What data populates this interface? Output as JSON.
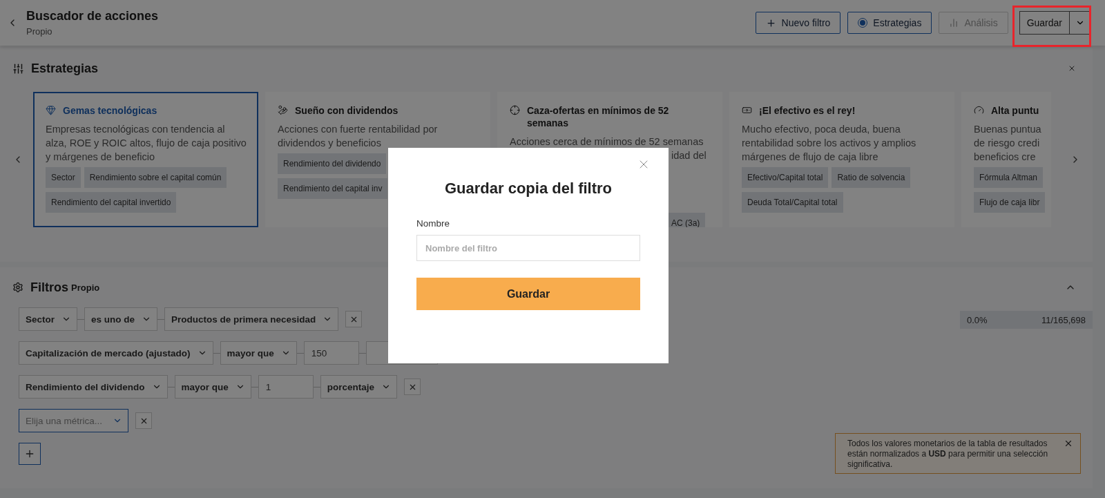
{
  "header": {
    "title": "Buscador de acciones",
    "subtitle": "Propio",
    "new_filter_button": {
      "label": "Nuevo filtro"
    },
    "strategies_toggle": {
      "label": "Estrategias",
      "checked": true
    },
    "analysis_button": {
      "label": "Análisis",
      "disabled": true
    },
    "save_button": {
      "label": "Guardar",
      "highlighted": true
    }
  },
  "strategies": {
    "title": "Estrategias",
    "cards": [
      {
        "kind": "full",
        "selected": true,
        "title": "Gemas tecnológicas",
        "description": "Empresas tecnológicas con tendencia al alza, ROE y ROIC altos, flujo de caja positivo y márgenes de beneficio",
        "tags": [
          "Sector",
          "Rendimiento sobre el capital común",
          "Rendimiento del capital invertido"
        ]
      },
      {
        "kind": "full",
        "selected": false,
        "title": "Sueño con dividendos",
        "description": "Acciones con fuerte rentabilidad por dividendos y beneficios",
        "tags": [
          "Rendimiento del dividendo",
          "Rendimiento del capital inv"
        ]
      },
      {
        "kind": "covered",
        "selected": false,
        "title": "Caza-ofertas en mínimos de 52 semanas",
        "description": "Acciones cerca de mínimos de 52 semanas",
        "description_tail": "idad del",
        "tag_tail": "AC (3a)"
      },
      {
        "kind": "full",
        "selected": false,
        "title": "¡El efectivo es el rey!",
        "description": "Mucho efectivo, poca deuda, buena rentabilidad sobre los activos y amplios márgenes de flujo de caja libre",
        "tags": [
          "Efectivo/Capital total",
          "Ratio de solvencia",
          "Deuda Total/Capital total"
        ]
      },
      {
        "kind": "cut",
        "selected": false,
        "title": "Alta puntu",
        "description_lines": [
          "Buenas puntua",
          "de riesgo credi",
          "beneficios cre"
        ],
        "tags": [
          "Fórmula Altman",
          "Flujo de caja libr"
        ]
      }
    ]
  },
  "filters": {
    "title": "Filtros",
    "subtitle": "Propio",
    "conditions": [
      {
        "parts": [
          {
            "kind": "select",
            "value": "Sector"
          },
          {
            "kind": "select",
            "value": "es uno de"
          },
          {
            "kind": "select",
            "value": "Productos de primera necesidad"
          },
          {
            "kind": "remove"
          }
        ]
      },
      {
        "parts": [
          {
            "kind": "select",
            "value": "Capitalización de mercado (ajustado)"
          },
          {
            "kind": "select",
            "value": "mayor que"
          },
          {
            "kind": "input",
            "value": "150"
          },
          {
            "kind": "covered"
          }
        ]
      },
      {
        "parts": [
          {
            "kind": "select",
            "value": "Rendimiento del dividendo"
          },
          {
            "kind": "select",
            "value": "mayor que"
          },
          {
            "kind": "input",
            "value": "1"
          },
          {
            "kind": "select",
            "value": "porcentaje"
          },
          {
            "kind": "remove"
          }
        ]
      },
      {
        "parts": [
          {
            "kind": "placeholder",
            "value": "Elija una métrica..."
          },
          {
            "kind": "remove"
          }
        ]
      }
    ],
    "stats": {
      "share": "0.0%",
      "count": "11/165,698"
    }
  },
  "notice": {
    "text": "Todos los valores monetarios de la tabla de resultados están normalizados a **USD** para permitir una selección significativa."
  },
  "modal": {
    "title": "Guardar copia del filtro",
    "label": "Nombre",
    "placeholder": "Nombre del filtro",
    "button": "Guardar"
  }
}
